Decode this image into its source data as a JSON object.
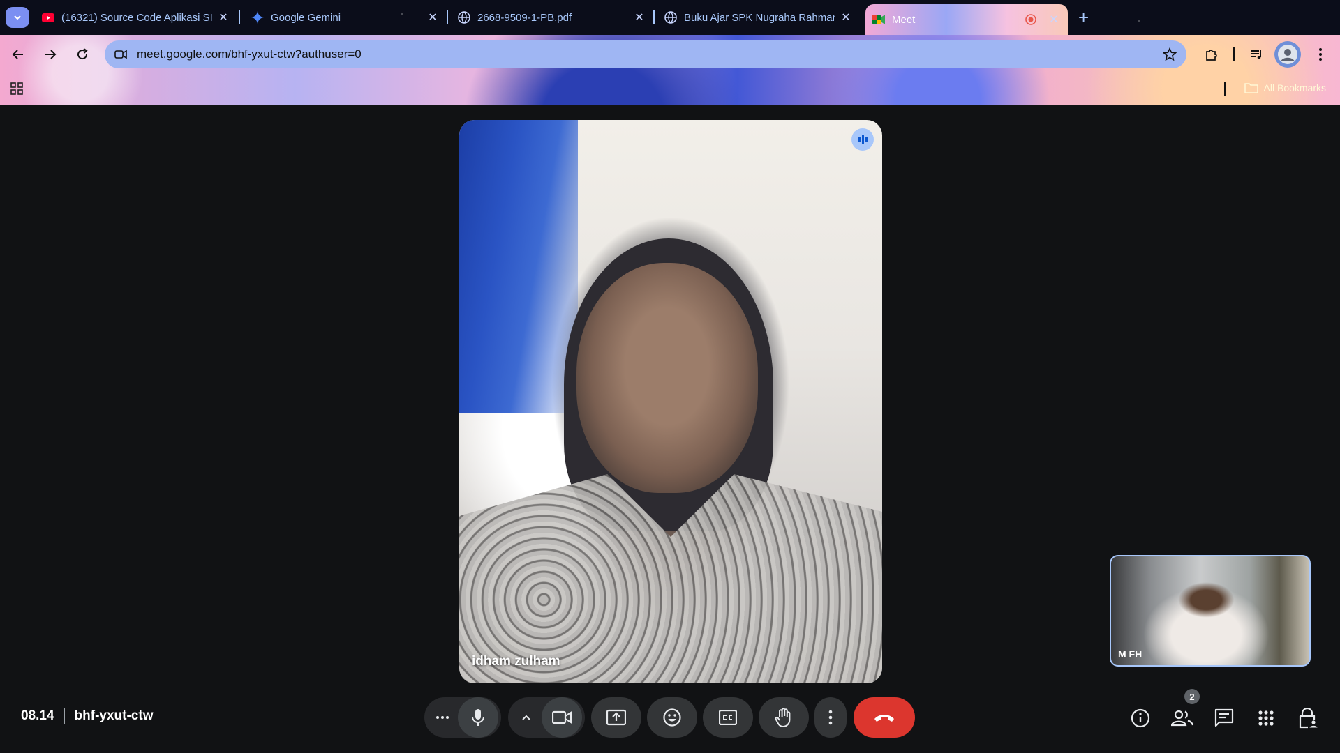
{
  "browser": {
    "tabs": [
      {
        "title": "(16321) Source Code Aplikasi SI",
        "icon": "youtube-icon",
        "active": false
      },
      {
        "title": "Google Gemini",
        "icon": "gemini-icon",
        "active": false
      },
      {
        "title": "2668-9509-1-PB.pdf",
        "icon": "globe-icon",
        "active": false
      },
      {
        "title": "Buku Ajar SPK Nugraha Rahman",
        "icon": "globe-icon",
        "active": false
      },
      {
        "title": "Meet",
        "icon": "meet-icon",
        "active": true
      }
    ],
    "new_tab": "+",
    "close_glyph": "✕",
    "url": "meet.google.com/bhf-yxut-ctw?authuser=0",
    "bookmarks_label": "All Bookmarks"
  },
  "meet": {
    "main_participant": "idham zulham",
    "self_participant": "M FH",
    "time": "08.14",
    "meeting_code": "bhf-yxut-ctw",
    "participants_count": "2"
  },
  "colors": {
    "end_call": "#dc362e",
    "accent": "#a8c7fa",
    "control_bg": "#333537"
  }
}
